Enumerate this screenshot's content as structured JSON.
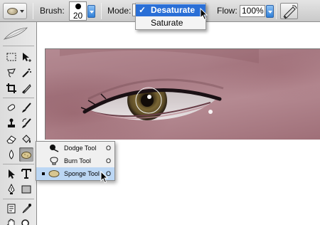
{
  "options_bar": {
    "tool_preset_icon": "sponge-icon",
    "brush_label": "Brush:",
    "brush_size": "20",
    "mode_label": "Mode:",
    "mode_menu": {
      "options": [
        {
          "label": "Desaturate",
          "checked": true
        },
        {
          "label": "Saturate",
          "checked": false
        }
      ],
      "check_glyph": "✓"
    },
    "flow_label": "Flow:",
    "flow_value": "100%",
    "airbrush_icon": "airbrush-icon"
  },
  "toolbox": {
    "logo_icon": "feather-icon",
    "tools": [
      "marquee-icon",
      "move-icon",
      "lasso-icon",
      "magic-wand-icon",
      "crop-icon",
      "slice-icon",
      "healing-brush-icon",
      "brush-icon",
      "clone-stamp-icon",
      "history-brush-icon",
      "eraser-icon",
      "paint-bucket-icon",
      "blur-icon",
      "sponge-icon",
      "path-selection-icon",
      "type-icon",
      "pen-icon",
      "shape-icon",
      "notes-icon",
      "eyedropper-icon",
      "hand-icon",
      "zoom-icon"
    ]
  },
  "flyout": {
    "items": [
      {
        "label": "Dodge Tool",
        "shortcut": "O",
        "icon": "dodge-icon",
        "active": false
      },
      {
        "label": "Burn Tool",
        "shortcut": "O",
        "icon": "burn-icon",
        "active": false
      },
      {
        "label": "Sponge Tool",
        "shortcut": "O",
        "icon": "sponge-icon",
        "active": true
      }
    ]
  },
  "colors": {
    "menu_highlight": "#2a6fd6",
    "flyout_highlight": "#bcd7f4",
    "skin": "#b48a92",
    "iris": "#6b5a30"
  }
}
